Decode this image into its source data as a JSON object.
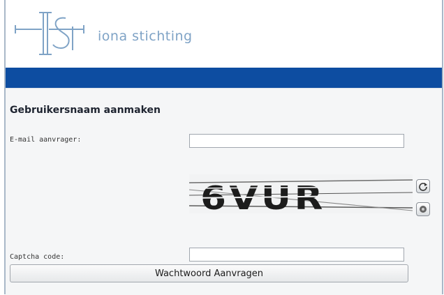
{
  "brand": {
    "name": "iona stichting",
    "logo_letters": "IS",
    "color": "#7fa3c6"
  },
  "theme": {
    "header_bar": "#0d4da1"
  },
  "form": {
    "title": "Gebruikersnaam aanmaken",
    "email_label": "E-mail aanvrager:",
    "email_value": "",
    "captcha_image_text": "6VUR",
    "captcha_label": "Captcha code:",
    "captcha_value": "",
    "refresh_icon": "refresh-icon",
    "audio_icon": "audio-icon",
    "submit_label": "Wachtwoord Aanvragen"
  }
}
